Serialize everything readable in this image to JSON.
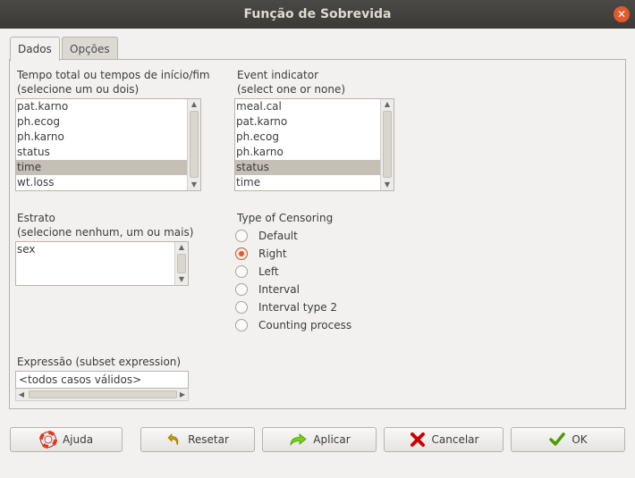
{
  "window": {
    "title": "Função de Sobrevida",
    "close_icon": "close-icon"
  },
  "tabs": [
    {
      "label": "Dados"
    },
    {
      "label": "Opções"
    }
  ],
  "time_list": {
    "label_line1": "Tempo total ou tempos de início/fim",
    "label_line2": "(selecione um ou dois)",
    "items": [
      "pat.karno",
      "ph.ecog",
      "ph.karno",
      "status",
      "time",
      "wt.loss"
    ],
    "selected": "time"
  },
  "event_list": {
    "label_line1": "Event indicator",
    "label_line2": "(select one or none)",
    "items": [
      "meal.cal",
      "pat.karno",
      "ph.ecog",
      "ph.karno",
      "status",
      "time"
    ],
    "selected": "status"
  },
  "strata_list": {
    "label_line1": "Estrato",
    "label_line2": "(selecione nenhum, um ou mais)",
    "items": [
      "sex"
    ]
  },
  "censoring": {
    "label": "Type of Censoring",
    "options": [
      "Default",
      "Right",
      "Left",
      "Interval",
      "Interval type 2",
      "Counting process"
    ],
    "selected": "Right"
  },
  "subset": {
    "label": "Expressão (subset expression)",
    "value": "<todos casos válidos>"
  },
  "buttons": {
    "help": "Ajuda",
    "reset": "Resetar",
    "apply": "Aplicar",
    "cancel": "Cancelar",
    "ok": "OK"
  },
  "colors": {
    "titlebar": "#3b3a37",
    "selection": "#c6bfb6",
    "radio_accent": "#e05a2b",
    "apply_icon": "#4e9a06",
    "cancel_icon": "#cc0000"
  }
}
